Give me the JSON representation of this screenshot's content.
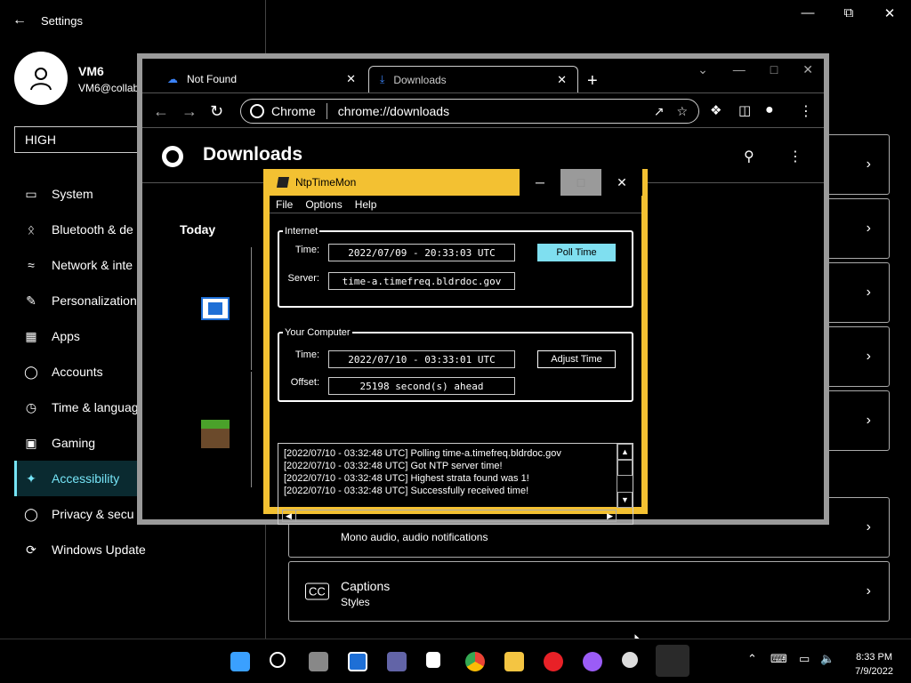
{
  "settings": {
    "title": "Settings",
    "user": {
      "name": "VM6",
      "email": "VM6@collab"
    },
    "search_value": "HIGH",
    "nav": [
      {
        "label": "System",
        "icon": "monitor-icon"
      },
      {
        "label": "Bluetooth & de",
        "icon": "bluetooth-icon"
      },
      {
        "label": "Network & inte",
        "icon": "wifi-icon"
      },
      {
        "label": "Personalization",
        "icon": "brush-icon"
      },
      {
        "label": "Apps",
        "icon": "apps-icon"
      },
      {
        "label": "Accounts",
        "icon": "person-icon"
      },
      {
        "label": "Time & languag",
        "icon": "clock-globe-icon"
      },
      {
        "label": "Gaming",
        "icon": "gamepad-icon"
      },
      {
        "label": "Accessibility",
        "icon": "accessibility-icon"
      },
      {
        "label": "Privacy & secu",
        "icon": "shield-icon"
      },
      {
        "label": "Windows Update",
        "icon": "update-icon"
      }
    ],
    "cards": {
      "audio_subtitle": "Mono audio, audio notifications",
      "captions_title": "Captions",
      "captions_subtitle": "Styles",
      "captions_icon": "CC"
    }
  },
  "chrome": {
    "tabs": [
      {
        "label": "Not Found"
      },
      {
        "label": "Downloads"
      }
    ],
    "omnibox": {
      "chip": "Chrome",
      "url": "chrome://downloads"
    },
    "page_title": "Downloads",
    "section_today": "Today"
  },
  "ntp": {
    "title": "NtpTimeMon",
    "menu": [
      "File",
      "Options",
      "Help"
    ],
    "internet": {
      "legend": "Internet",
      "time_label": "Time:",
      "time_value": "2022/07/09 - 20:33:03 UTC",
      "server_label": "Server:",
      "server_value": "time-a.timefreq.bldrdoc.gov",
      "poll_button": "Poll Time"
    },
    "computer": {
      "legend": "Your Computer",
      "time_label": "Time:",
      "time_value": "2022/07/10 - 03:33:01 UTC",
      "offset_label": "Offset:",
      "offset_value": "25198 second(s) ahead",
      "adjust_button": "Adjust Time"
    },
    "log": [
      "[2022/07/10 - 03:32:48 UTC] Polling time-a.timefreq.bldrdoc.gov",
      "[2022/07/10 - 03:32:48 UTC] Got NTP server time!",
      "[2022/07/10 - 03:32:48 UTC] Highest strata found was 1!",
      "[2022/07/10 - 03:32:48 UTC] Successfully received time!"
    ]
  },
  "taskbar": {
    "time": "8:33 PM",
    "date": "7/9/2022"
  }
}
